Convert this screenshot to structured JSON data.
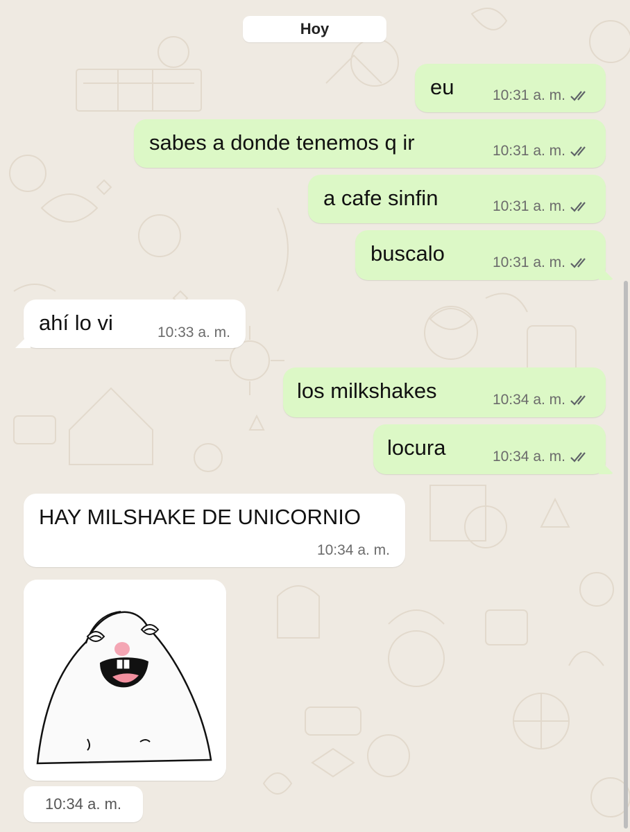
{
  "chat": {
    "date_label": "Hoy",
    "messages": [
      {
        "text": "eu",
        "time": "10:31 a. m.",
        "direction": "outgoing",
        "status_icon": "double-check-icon"
      },
      {
        "text": "sabes a donde tenemos q ir",
        "time": "10:31 a. m.",
        "direction": "outgoing",
        "status_icon": "double-check-icon"
      },
      {
        "text": "a cafe sinfin",
        "time": "10:31 a. m.",
        "direction": "outgoing",
        "status_icon": "double-check-icon"
      },
      {
        "text": "buscalo",
        "time": "10:31 a. m.",
        "direction": "outgoing",
        "status_icon": "double-check-icon"
      },
      {
        "text": "ahí lo vi",
        "time": "10:33 a. m.",
        "direction": "incoming"
      },
      {
        "text": "los milkshakes",
        "time": "10:34 a. m.",
        "direction": "outgoing",
        "status_icon": "double-check-icon"
      },
      {
        "text": "locura",
        "time": "10:34 a. m.",
        "direction": "outgoing",
        "status_icon": "double-check-icon"
      },
      {
        "text": "HAY MILSHAKE DE UNICORNIO",
        "time": "10:34 a. m.",
        "direction": "incoming"
      }
    ],
    "sticker": {
      "icon": "laughing-hamster-sticker",
      "time": "10:34 a. m.",
      "direction": "incoming"
    }
  },
  "colors": {
    "background": "#efeae2",
    "outgoing_bubble": "#dcf8c6",
    "incoming_bubble": "#ffffff",
    "ticks": "#5f6368"
  }
}
